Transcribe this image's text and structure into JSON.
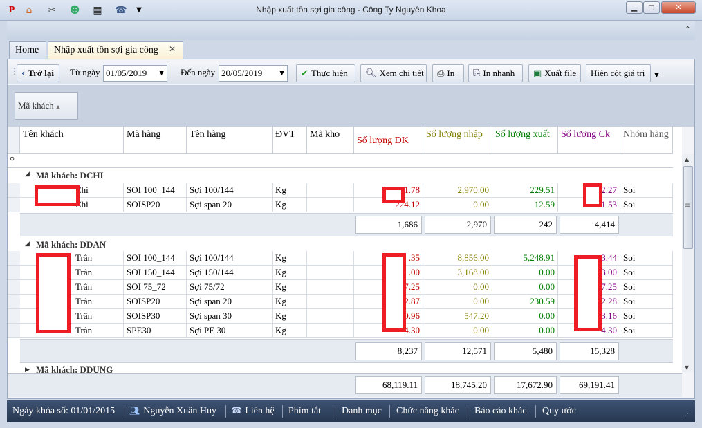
{
  "window": {
    "title": "Nhập xuất tồn sợi gia công - Công Ty Nguyên Khoa"
  },
  "tabs": [
    {
      "label": "Home"
    },
    {
      "label": "Nhập xuất tồn sợi gia công"
    }
  ],
  "toolbar": {
    "back_label": "Trở lại",
    "from_label": "Từ ngày",
    "from_value": "01/05/2019",
    "to_label": "Đến ngày",
    "to_value": "20/05/2019",
    "execute_label": "Thực hiện",
    "detail_label": "Xem chi tiết",
    "print_label": "In",
    "quick_print_label": "In nhanh",
    "export_label": "Xuất file",
    "show_value_label": "Hiện cột giá trị"
  },
  "group_panel": {
    "chip": "Mã khách"
  },
  "columns": [
    "Tên khách",
    "Mã hàng",
    "Tên hàng",
    "ĐVT",
    "Mã kho",
    "Số lượng ĐK",
    "Số lượng nhập",
    "Số lượng xuất",
    "Số lượng Ck",
    "Nhóm hàng"
  ],
  "groups": [
    {
      "header": "Mã khách: DCHI",
      "rows": [
        {
          "name": "Chi",
          "code": "SOI 100_144",
          "item": "Sợi 100/144",
          "unit": "Kg",
          "dk": "1.78",
          "nhap": "2,970.00",
          "xuat": "229.51",
          "ck": "2.27",
          "group": "Soi"
        },
        {
          "name": "Chi",
          "code": "SOISP20",
          "item": "Sợi span 20",
          "unit": "Kg",
          "dk": "224.12",
          "nhap": "0.00",
          "xuat": "12.59",
          "ck": "1.53",
          "group": "Soi"
        }
      ],
      "sum": {
        "dk": "1,686",
        "nhap": "2,970",
        "xuat": "242",
        "ck": "4,414"
      }
    },
    {
      "header": "Mã khách: DDAN",
      "rows": [
        {
          "name": "Trân",
          "code": "SOI 100_144",
          "item": "Sợi 100/144",
          "unit": "Kg",
          "dk": ".35",
          "nhap": "8,856.00",
          "xuat": "5,248.91",
          "ck": "3.44",
          "group": "Soi"
        },
        {
          "name": "Trân",
          "code": "SOI 150_144",
          "item": "Sợi 150/144",
          "unit": "Kg",
          "dk": ".00",
          "nhap": "3,168.00",
          "xuat": "0.00",
          "ck": "3.00",
          "group": "Soi"
        },
        {
          "name": "Trân",
          "code": "SOI 75_72",
          "item": "Sợi 75/72",
          "unit": "Kg",
          "dk": "7.25",
          "nhap": "0.00",
          "xuat": "0.00",
          "ck": "7.25",
          "group": "Soi"
        },
        {
          "name": "Trân",
          "code": "SOISP20",
          "item": "Sợi span 20",
          "unit": "Kg",
          "dk": "2.87",
          "nhap": "0.00",
          "xuat": "230.59",
          "ck": "2.28",
          "group": "Soi"
        },
        {
          "name": "Trân",
          "code": "SOISP30",
          "item": "Sợi span 30",
          "unit": "Kg",
          "dk": "0.96",
          "nhap": "547.20",
          "xuat": "0.00",
          "ck": "3.16",
          "group": "Soi"
        },
        {
          "name": "Trân",
          "code": "SPE30",
          "item": "Sợi PE 30",
          "unit": "Kg",
          "dk": "4.30",
          "nhap": "0.00",
          "xuat": "0.00",
          "ck": "4.30",
          "group": "Soi"
        }
      ],
      "sum": {
        "dk": "8,237",
        "nhap": "12,571",
        "xuat": "5,480",
        "ck": "15,328"
      }
    }
  ],
  "collapsed_group": "Mã khách: DDUNG",
  "grand_total": {
    "dk": "68,119.11",
    "nhap": "18,745.20",
    "xuat": "17,672.90",
    "ck": "69,191.41"
  },
  "statusbar": {
    "lock_date": "Ngày khóa số: 01/01/2015",
    "user": "Nguyễn Xuân Huy",
    "contact": "Liên hệ",
    "shortcuts": "Phím tắt",
    "catalog": "Danh mục",
    "other_functions": "Chức năng khác",
    "other_reports": "Báo cáo khác",
    "conventions": "Quy ước"
  },
  "colors": {
    "dk": "#c00000",
    "nhap": "#808000",
    "xuat": "#008000",
    "ck": "#800080",
    "mask": "#ee1c25",
    "status_bg": "#26374f"
  }
}
